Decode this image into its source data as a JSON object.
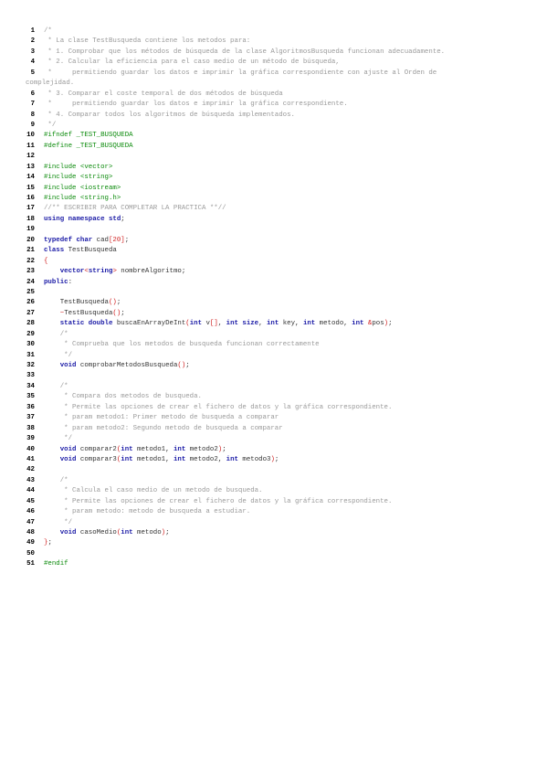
{
  "document": {
    "lines": [
      {
        "n": "1",
        "segs": [
          [
            "c",
            "/*"
          ]
        ]
      },
      {
        "n": "2",
        "segs": [
          [
            "c",
            " * La clase TestBusqueda contiene los metodos para:"
          ]
        ]
      },
      {
        "n": "3",
        "segs": [
          [
            "c",
            " * 1. Comprobar que los métodos de búsqueda de la clase AlgoritmosBusqueda funcionan adecuadamente."
          ]
        ]
      },
      {
        "n": "4",
        "segs": [
          [
            "c",
            " * 2. Calcular la eficiencia para el caso medio de un método de búsqueda,"
          ]
        ]
      },
      {
        "n": "5",
        "segs": [
          [
            "c",
            " *     permitiendo guardar los datos e imprimir la gráfica correspondiente con ajuste al Orden de"
          ]
        ]
      },
      {
        "n": "",
        "wrap": true,
        "segs": [
          [
            "c",
            "complejidad."
          ]
        ]
      },
      {
        "n": "6",
        "segs": [
          [
            "c",
            " * 3. Comparar el coste temporal de dos métodos de búsqueda"
          ]
        ]
      },
      {
        "n": "7",
        "segs": [
          [
            "c",
            " *     permitiendo guardar los datos e imprimir la gráfica correspondiente."
          ]
        ]
      },
      {
        "n": "8",
        "segs": [
          [
            "c",
            " * 4. Comparar todos los algoritmos de búsqueda implementados."
          ]
        ]
      },
      {
        "n": "9",
        "segs": [
          [
            "c",
            " */"
          ]
        ]
      },
      {
        "n": "10",
        "segs": [
          [
            "p",
            "#ifndef _TEST_BUSQUEDA"
          ]
        ]
      },
      {
        "n": "11",
        "segs": [
          [
            "p",
            "#define _TEST_BUSQUEDA"
          ]
        ]
      },
      {
        "n": "12",
        "segs": []
      },
      {
        "n": "13",
        "segs": [
          [
            "p",
            "#include <vector>"
          ]
        ]
      },
      {
        "n": "14",
        "segs": [
          [
            "p",
            "#include <string>"
          ]
        ]
      },
      {
        "n": "15",
        "segs": [
          [
            "p",
            "#include <iostream>"
          ]
        ]
      },
      {
        "n": "16",
        "segs": [
          [
            "p",
            "#include <string.h>"
          ]
        ]
      },
      {
        "n": "17",
        "segs": [
          [
            "c",
            "//** ESCRIBIR PARA COMPLETAR LA PRACTICA **//"
          ]
        ]
      },
      {
        "n": "18",
        "segs": [
          [
            "k",
            "using namespace std"
          ],
          [
            "t",
            ";"
          ]
        ]
      },
      {
        "n": "19",
        "segs": []
      },
      {
        "n": "20",
        "segs": [
          [
            "k",
            "typedef char"
          ],
          [
            "t",
            " cad"
          ],
          [
            "n",
            "[20]"
          ],
          [
            "t",
            ";"
          ]
        ]
      },
      {
        "n": "21",
        "segs": [
          [
            "k",
            "class"
          ],
          [
            "t",
            " TestBusqueda"
          ]
        ]
      },
      {
        "n": "22",
        "segs": [
          [
            "sym",
            "{"
          ]
        ]
      },
      {
        "n": "23",
        "segs": [
          [
            "t",
            "    "
          ],
          [
            "k",
            "vector"
          ],
          [
            "sym",
            "<"
          ],
          [
            "k",
            "string"
          ],
          [
            "sym",
            ">"
          ],
          [
            "t",
            " nombreAlgoritmo;"
          ]
        ]
      },
      {
        "n": "24",
        "segs": [
          [
            "k",
            "public"
          ],
          [
            "t",
            ":"
          ]
        ]
      },
      {
        "n": "25",
        "segs": []
      },
      {
        "n": "26",
        "segs": [
          [
            "t",
            "    TestBusqueda"
          ],
          [
            "sym",
            "()"
          ],
          [
            "t",
            ";"
          ]
        ]
      },
      {
        "n": "27",
        "segs": [
          [
            "t",
            "    "
          ],
          [
            "sym",
            "~"
          ],
          [
            "t",
            "TestBusqueda"
          ],
          [
            "sym",
            "()"
          ],
          [
            "t",
            ";"
          ]
        ]
      },
      {
        "n": "28",
        "segs": [
          [
            "t",
            "    "
          ],
          [
            "k",
            "static double"
          ],
          [
            "t",
            " buscaEnArrayDeInt"
          ],
          [
            "sym",
            "("
          ],
          [
            "k",
            "int"
          ],
          [
            "t",
            " v"
          ],
          [
            "sym",
            "[]"
          ],
          [
            "t",
            ", "
          ],
          [
            "k",
            "int size"
          ],
          [
            "t",
            ", "
          ],
          [
            "k",
            "int"
          ],
          [
            "t",
            " key, "
          ],
          [
            "k",
            "int"
          ],
          [
            "t",
            " metodo, "
          ],
          [
            "k",
            "int"
          ],
          [
            "t",
            " "
          ],
          [
            "sym",
            "&"
          ],
          [
            "t",
            "pos"
          ],
          [
            "sym",
            ")"
          ],
          [
            "t",
            ";"
          ]
        ]
      },
      {
        "n": "29",
        "segs": [
          [
            "c",
            "    /*"
          ]
        ]
      },
      {
        "n": "30",
        "segs": [
          [
            "c",
            "     * Comprueba que los metodos de busqueda funcionan correctamente"
          ]
        ]
      },
      {
        "n": "31",
        "segs": [
          [
            "c",
            "     */"
          ]
        ]
      },
      {
        "n": "32",
        "segs": [
          [
            "t",
            "    "
          ],
          [
            "k",
            "void"
          ],
          [
            "t",
            " comprobarMetodosBusqueda"
          ],
          [
            "sym",
            "()"
          ],
          [
            "t",
            ";"
          ]
        ]
      },
      {
        "n": "33",
        "segs": []
      },
      {
        "n": "34",
        "segs": [
          [
            "c",
            "    /*"
          ]
        ]
      },
      {
        "n": "35",
        "segs": [
          [
            "c",
            "     * Compara dos metodos de busqueda."
          ]
        ]
      },
      {
        "n": "36",
        "segs": [
          [
            "c",
            "     * Permite las opciones de crear el fichero de datos y la gráfica correspondiente."
          ]
        ]
      },
      {
        "n": "37",
        "segs": [
          [
            "c",
            "     * param metodo1: Primer metodo de busqueda a comparar"
          ]
        ]
      },
      {
        "n": "38",
        "segs": [
          [
            "c",
            "     * param metodo2: Segundo metodo de busqueda a comparar"
          ]
        ]
      },
      {
        "n": "39",
        "segs": [
          [
            "c",
            "     */"
          ]
        ]
      },
      {
        "n": "40",
        "segs": [
          [
            "t",
            "    "
          ],
          [
            "k",
            "void"
          ],
          [
            "t",
            " comparar2"
          ],
          [
            "sym",
            "("
          ],
          [
            "k",
            "int"
          ],
          [
            "t",
            " metodo1, "
          ],
          [
            "k",
            "int"
          ],
          [
            "t",
            " metodo2"
          ],
          [
            "sym",
            ")"
          ],
          [
            "t",
            ";"
          ]
        ]
      },
      {
        "n": "41",
        "segs": [
          [
            "t",
            "    "
          ],
          [
            "k",
            "void"
          ],
          [
            "t",
            " comparar3"
          ],
          [
            "sym",
            "("
          ],
          [
            "k",
            "int"
          ],
          [
            "t",
            " metodo1, "
          ],
          [
            "k",
            "int"
          ],
          [
            "t",
            " metodo2, "
          ],
          [
            "k",
            "int"
          ],
          [
            "t",
            " metodo3"
          ],
          [
            "sym",
            ")"
          ],
          [
            "t",
            ";"
          ]
        ]
      },
      {
        "n": "42",
        "segs": []
      },
      {
        "n": "43",
        "segs": [
          [
            "c",
            "    /*"
          ]
        ]
      },
      {
        "n": "44",
        "segs": [
          [
            "c",
            "     * Calcula el caso medio de un metodo de busqueda."
          ]
        ]
      },
      {
        "n": "45",
        "segs": [
          [
            "c",
            "     * Permite las opciones de crear el fichero de datos y la gráfica correspondiente."
          ]
        ]
      },
      {
        "n": "46",
        "segs": [
          [
            "c",
            "     * param metodo: metodo de busqueda a estudiar."
          ]
        ]
      },
      {
        "n": "47",
        "segs": [
          [
            "c",
            "     */"
          ]
        ]
      },
      {
        "n": "48",
        "segs": [
          [
            "t",
            "    "
          ],
          [
            "k",
            "void"
          ],
          [
            "t",
            " casoMedio"
          ],
          [
            "sym",
            "("
          ],
          [
            "k",
            "int"
          ],
          [
            "t",
            " metodo"
          ],
          [
            "sym",
            ")"
          ],
          [
            "t",
            ";"
          ]
        ]
      },
      {
        "n": "49",
        "segs": [
          [
            "sym",
            "}"
          ],
          [
            "t",
            ";"
          ]
        ]
      },
      {
        "n": "50",
        "segs": []
      },
      {
        "n": "51",
        "segs": [
          [
            "p",
            "#endif"
          ]
        ]
      }
    ]
  }
}
